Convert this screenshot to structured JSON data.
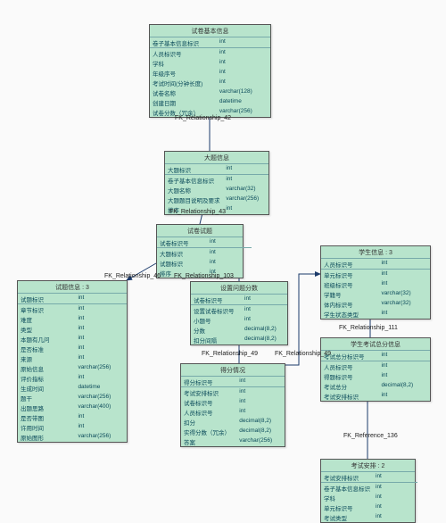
{
  "entities": {
    "e1": {
      "title": "试卷基本信息",
      "rows": [
        {
          "name": "卷子基本信息标识",
          "type": "int",
          "key": "<pk>",
          "cls": "pk"
        },
        {
          "name": "人员标识号",
          "type": "int",
          "key": "",
          "cls": ""
        },
        {
          "name": "学科",
          "type": "int",
          "key": "",
          "cls": ""
        },
        {
          "name": "年级序号",
          "type": "int",
          "key": "",
          "cls": ""
        },
        {
          "name": "考试时间(分钟长度)",
          "type": "int",
          "key": "",
          "cls": ""
        },
        {
          "name": "试卷名称",
          "type": "varchar(128)",
          "key": "",
          "cls": ""
        },
        {
          "name": "创建日期",
          "type": "datetime",
          "key": "",
          "cls": ""
        },
        {
          "name": "试卷分数（冗余）",
          "type": "varchar(256)",
          "key": "",
          "cls": ""
        }
      ]
    },
    "e2": {
      "title": "大题信息",
      "rows": [
        {
          "name": "大题标识",
          "type": "int",
          "key": "<pk>",
          "cls": "pk"
        },
        {
          "name": "卷子基本信息标识",
          "type": "int",
          "key": "<fk>",
          "cls": "fk"
        },
        {
          "name": "大题名称",
          "type": "varchar(32)",
          "key": "",
          "cls": ""
        },
        {
          "name": "大题题目说明及要求",
          "type": "varchar(256)",
          "key": "",
          "cls": ""
        },
        {
          "name": "排序",
          "type": "int",
          "key": "",
          "cls": ""
        }
      ]
    },
    "e3": {
      "title": "试卷试题",
      "rows": [
        {
          "name": "试卷标识号",
          "type": "int",
          "key": "<pk>",
          "cls": "pk"
        },
        {
          "name": "大题标识",
          "type": "int",
          "key": "<fk1>",
          "cls": "fk"
        },
        {
          "name": "试题标识",
          "type": "int",
          "key": "<fk2>",
          "cls": "fk"
        },
        {
          "name": "排序",
          "type": "int",
          "key": "",
          "cls": ""
        }
      ]
    },
    "e4": {
      "title": "试题信息 : 3",
      "rows": [
        {
          "name": "试题标识",
          "type": "int",
          "key": "<pk>",
          "cls": "pk"
        },
        {
          "name": "章节标识",
          "type": "int",
          "key": "",
          "cls": ""
        },
        {
          "name": "难度",
          "type": "int",
          "key": "",
          "cls": ""
        },
        {
          "name": "类型",
          "type": "int",
          "key": "",
          "cls": ""
        },
        {
          "name": "本题有几问",
          "type": "int",
          "key": "",
          "cls": ""
        },
        {
          "name": "是否标准",
          "type": "int",
          "key": "",
          "cls": ""
        },
        {
          "name": "来源",
          "type": "int",
          "key": "",
          "cls": ""
        },
        {
          "name": "原始信息",
          "type": "varchar(256)",
          "key": "",
          "cls": ""
        },
        {
          "name": "评价指标",
          "type": "int",
          "key": "",
          "cls": ""
        },
        {
          "name": "生成时间",
          "type": "datetime",
          "key": "",
          "cls": ""
        },
        {
          "name": "题干",
          "type": "varchar(256)",
          "key": "",
          "cls": ""
        },
        {
          "name": "出题思路",
          "type": "varchar(400)",
          "key": "",
          "cls": ""
        },
        {
          "name": "是否带图",
          "type": "int",
          "key": "",
          "cls": ""
        },
        {
          "name": "许用时间",
          "type": "int",
          "key": "",
          "cls": ""
        },
        {
          "name": "原始图形",
          "type": "varchar(256)",
          "key": "",
          "cls": ""
        }
      ]
    },
    "e5": {
      "title": "设置问题分数",
      "rows": [
        {
          "name": "试卷标识号",
          "type": "int",
          "key": "<pk>",
          "cls": "pk"
        },
        {
          "name": "设置试卷标识号",
          "type": "int",
          "key": "<fk1>",
          "cls": "fk"
        },
        {
          "name": "小题号",
          "type": "int",
          "key": "",
          "cls": ""
        },
        {
          "name": "分数",
          "type": "decimal(8,2)",
          "key": "",
          "cls": ""
        },
        {
          "name": "扣分间隔",
          "type": "decimal(8,2)",
          "key": "",
          "cls": ""
        }
      ]
    },
    "e6": {
      "title": "得分情况",
      "rows": [
        {
          "name": "得分标识号",
          "type": "int",
          "key": "<pk>",
          "cls": "pk"
        },
        {
          "name": "考试安排标识",
          "type": "int",
          "key": "<fk1>",
          "cls": "fk"
        },
        {
          "name": "试卷标识号",
          "type": "int",
          "key": "<fk2>",
          "cls": "fk"
        },
        {
          "name": "人员标识号",
          "type": "int",
          "key": "<fk3>",
          "cls": "fk"
        },
        {
          "name": "扣分",
          "type": "decimal(8,2)",
          "key": "",
          "cls": ""
        },
        {
          "name": "实得分数（冗余）",
          "type": "decimal(8,2)",
          "key": "",
          "cls": ""
        },
        {
          "name": "答案",
          "type": "varchar(256)",
          "key": "",
          "cls": ""
        }
      ]
    },
    "e7": {
      "title": "学生信息 : 3",
      "rows": [
        {
          "name": "人员标识号",
          "type": "int",
          "key": "<pk,fk3>",
          "cls": "pk"
        },
        {
          "name": "单元标识号",
          "type": "int",
          "key": "<fk1>",
          "cls": "fk"
        },
        {
          "name": "班级标识号",
          "type": "int",
          "key": "<fk2>",
          "cls": "fk"
        },
        {
          "name": "学籍号",
          "type": "varchar(32)",
          "key": "",
          "cls": ""
        },
        {
          "name": "体内标识号",
          "type": "varchar(32)",
          "key": "",
          "cls": ""
        },
        {
          "name": "学生状态类型",
          "type": "int",
          "key": "",
          "cls": ""
        }
      ]
    },
    "e8": {
      "title": "学生考试总分信息",
      "rows": [
        {
          "name": "考试总分标识号",
          "type": "int",
          "key": "<pk>",
          "cls": "pk"
        },
        {
          "name": "人员标识号",
          "type": "int",
          "key": "<fk1>",
          "cls": "fk"
        },
        {
          "name": "得题标识号",
          "type": "int",
          "key": "<fk2>",
          "cls": "fk"
        },
        {
          "name": "考试总分",
          "type": "decimal(8,2)",
          "key": "",
          "cls": ""
        },
        {
          "name": "考试安排标识",
          "type": "int",
          "key": "<fk3>",
          "cls": "fk"
        }
      ]
    },
    "e9": {
      "title": "考试安排 : 2",
      "rows": [
        {
          "name": "考试安排标识",
          "type": "int",
          "key": "<pk>",
          "cls": "pk"
        },
        {
          "name": "卷子基本信息标识",
          "type": "int",
          "key": "<fk>",
          "cls": "fk"
        },
        {
          "name": "学科",
          "type": "int",
          "key": "",
          "cls": ""
        },
        {
          "name": "单元标识号",
          "type": "int",
          "key": "",
          "cls": ""
        },
        {
          "name": "考试类型",
          "type": "int",
          "key": "",
          "cls": ""
        }
      ]
    }
  },
  "relationships": {
    "r42": "FK_Relationship_42",
    "r43": "FK_Relationship_43",
    "r46": "FK_Relationship_46",
    "r103": "FK_Relationship_103",
    "r49a": "FK_Relationship_49",
    "r49b": "FK_Relationship_49",
    "r111": "FK_Relationship_111",
    "r136": "FK_Reference_136"
  },
  "colors": {
    "entity_fill": "#b8e4cc",
    "line": "#1b3a6a"
  }
}
